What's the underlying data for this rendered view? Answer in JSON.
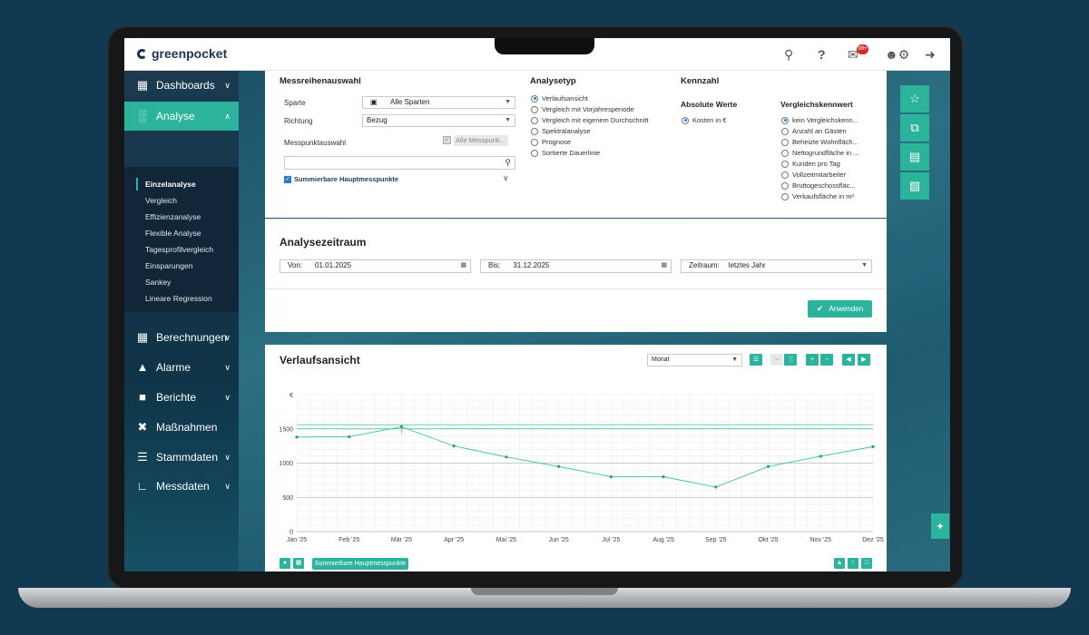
{
  "app": {
    "logo": "greenpocket",
    "notification_badge": "99+"
  },
  "sidebar": {
    "items": [
      {
        "label": "Dashboards",
        "icon": "dashboard-icon"
      },
      {
        "label": "Analyse",
        "icon": "bar-chart-icon"
      },
      {
        "label": "Berechnungen",
        "icon": "calculator-icon"
      },
      {
        "label": "Alarme",
        "icon": "bell-icon"
      },
      {
        "label": "Berichte",
        "icon": "report-icon"
      },
      {
        "label": "Maßnahmen",
        "icon": "tools-icon"
      },
      {
        "label": "Stammdaten",
        "icon": "master-data-icon"
      },
      {
        "label": "Messdaten",
        "icon": "measurement-icon"
      }
    ],
    "sub_items": [
      "Einzelanalyse",
      "Vergleich",
      "Effizienzanalyse",
      "Flexible Analyse",
      "Tagesprofilvergleich",
      "Einsparungen",
      "Sankey",
      "Lineare Regression"
    ]
  },
  "messreihen": {
    "title": "Messreihenauswahl",
    "sparte_label": "Sparte",
    "sparte_value": "Alle Sparten",
    "richtung_label": "Richtung",
    "richtung_value": "Bezug",
    "messpunkt_label": "Messpunktauswahl",
    "alle_messpunkte": "Alle Messpunk...",
    "summierbare": "Summierbare Hauptmesspunkte"
  },
  "analysetyp": {
    "title": "Analysetyp",
    "options": [
      "Verlaufsansicht",
      "Vergleich mit Vorjahresperiode",
      "Vergleich mit eigenem Durchschnitt",
      "Spektralanalyse",
      "Prognose",
      "Sortierte Dauerlinie"
    ]
  },
  "kennzahl": {
    "title": "Kennzahl",
    "absolute_title": "Absolute Werte",
    "absolute_option": "Kosten in €",
    "vergleich_title": "Vergleichskennwert",
    "vergleich_options": [
      "kein Vergleichskenn...",
      "Anzahl an Gästen",
      "Beheizte Wohnfläch...",
      "Nettogrundfläche in ...",
      "Kunden pro Tag",
      "Vollzeitmitarbeiter",
      "Bruttogeschossfläc...",
      "Verkaufsfläche in m²"
    ]
  },
  "zeitraum": {
    "title": "Analysezeitraum",
    "von_label": "Von:",
    "von_value": "01.01.2025",
    "bis_label": "Bis:",
    "bis_value": "31.12.2025",
    "zeitraum_label": "Zeitraum:",
    "zeitraum_value": "letztes Jahr",
    "apply": "Anwenden"
  },
  "chart_panel": {
    "title": "Verlaufsansicht",
    "interval": "Monat",
    "footer_tag": "Summierbare Hauptmesspunkte"
  },
  "chart_data": {
    "type": "line",
    "categories": [
      "Jan '25",
      "Feb '25",
      "Mär '25",
      "Apr '25",
      "Mai '25",
      "Jun '25",
      "Jul '25",
      "Aug '25",
      "Sep '25",
      "Okt '25",
      "Nov '25",
      "Dez '25"
    ],
    "values": [
      1380,
      1385,
      1530,
      1250,
      1090,
      950,
      800,
      800,
      650,
      950,
      1100,
      1240
    ],
    "yunit": "€",
    "yticks": [
      0,
      500,
      1000,
      1500
    ],
    "ylim": [
      0,
      2000
    ],
    "reference_lines": [
      1500,
      1560
    ],
    "color": "#3fbf9f",
    "max_marker_index": 2
  }
}
